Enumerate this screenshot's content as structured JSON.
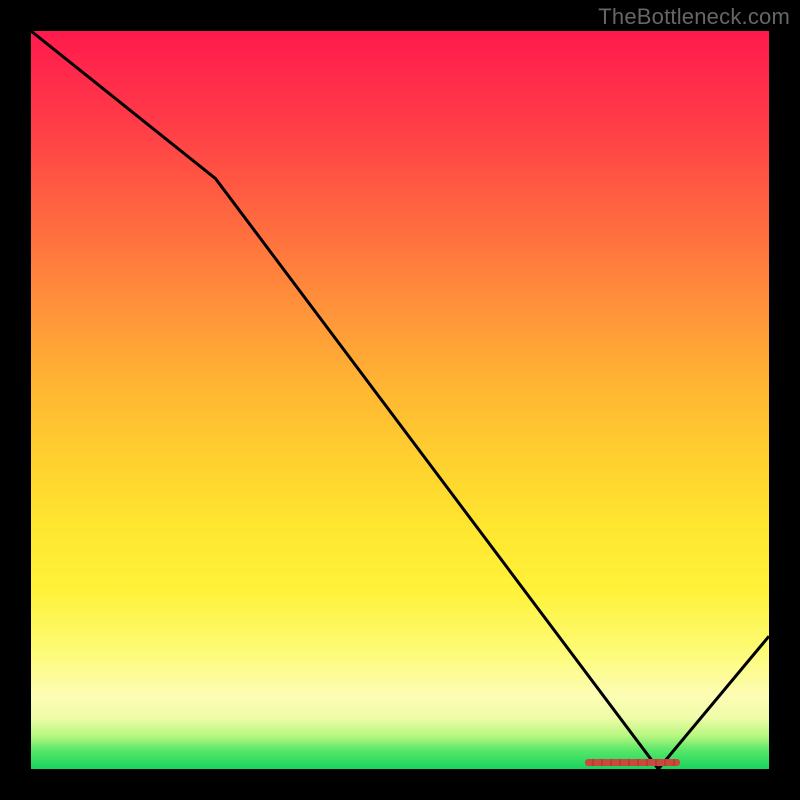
{
  "watermark": "TheBottleneck.com",
  "chart_data": {
    "type": "line",
    "title": "",
    "xlabel": "",
    "ylabel": "",
    "xlim": [
      0,
      100
    ],
    "ylim": [
      0,
      100
    ],
    "x": [
      0,
      25,
      85,
      100
    ],
    "values": [
      100,
      80,
      0,
      18
    ],
    "marker": {
      "x_start": 75,
      "x_end": 88,
      "y": 0.5
    },
    "background_gradient": {
      "direction": "vertical",
      "stops": [
        {
          "pos": 0,
          "color": "#ff1a4d"
        },
        {
          "pos": 0.5,
          "color": "#ffc733"
        },
        {
          "pos": 0.8,
          "color": "#fff24a"
        },
        {
          "pos": 0.95,
          "color": "#b7f780"
        },
        {
          "pos": 1.0,
          "color": "#18d35e"
        }
      ]
    }
  }
}
